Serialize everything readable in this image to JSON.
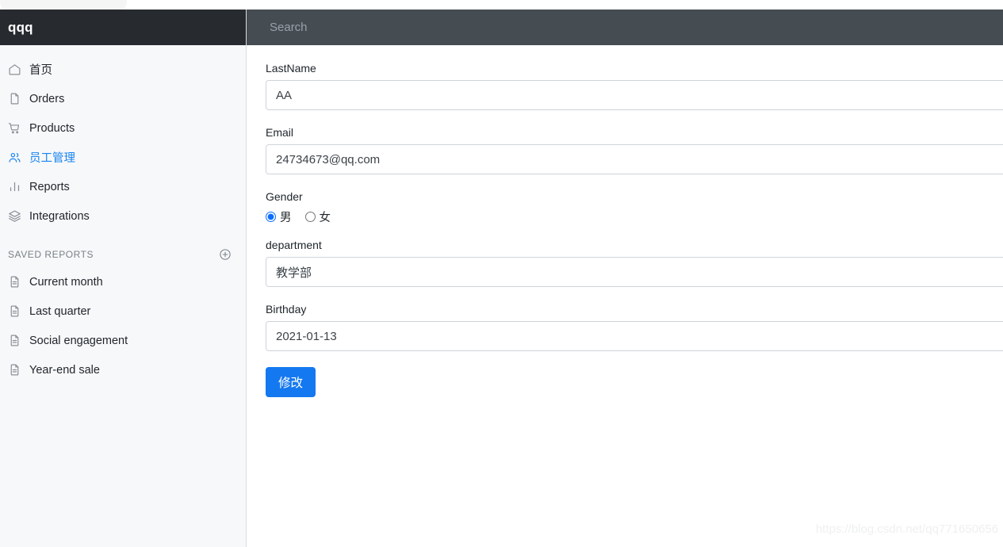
{
  "brand": {
    "title": "qqq"
  },
  "search": {
    "placeholder": "Search",
    "value": ""
  },
  "sidebar": {
    "nav": [
      {
        "label": "首页",
        "icon": "home-icon",
        "active": false
      },
      {
        "label": "Orders",
        "icon": "file-icon",
        "active": false
      },
      {
        "label": "Products",
        "icon": "cart-icon",
        "active": false
      },
      {
        "label": "员工管理",
        "icon": "people-icon",
        "active": true
      },
      {
        "label": "Reports",
        "icon": "bar-chart-icon",
        "active": false
      },
      {
        "label": "Integrations",
        "icon": "layers-icon",
        "active": false
      }
    ],
    "section": {
      "title": "SAVED REPORTS",
      "add_icon": "plus-circle-icon"
    },
    "reports": [
      {
        "label": "Current month",
        "icon": "document-icon"
      },
      {
        "label": "Last quarter",
        "icon": "document-icon"
      },
      {
        "label": "Social engagement",
        "icon": "document-icon"
      },
      {
        "label": "Year-end sale",
        "icon": "document-icon"
      }
    ]
  },
  "form": {
    "lastname": {
      "label": "LastName",
      "value": "AA"
    },
    "email": {
      "label": "Email",
      "value": "24734673@qq.com"
    },
    "gender": {
      "label": "Gender",
      "options": [
        {
          "label": "男",
          "selected": true
        },
        {
          "label": "女",
          "selected": false
        }
      ]
    },
    "department": {
      "label": "department",
      "value": "教学部"
    },
    "birthday": {
      "label": "Birthday",
      "value": "2021-01-13"
    },
    "submit": {
      "label": "修改"
    }
  },
  "watermark": {
    "text": "https://blog.csdn.net/qq771650656"
  },
  "colors": {
    "accent": "#1478f0",
    "active": "#1a85f0",
    "brand_bg": "#272b2f",
    "topbar_bg": "#454c52",
    "sidebar_bg": "#f7f8fa"
  }
}
